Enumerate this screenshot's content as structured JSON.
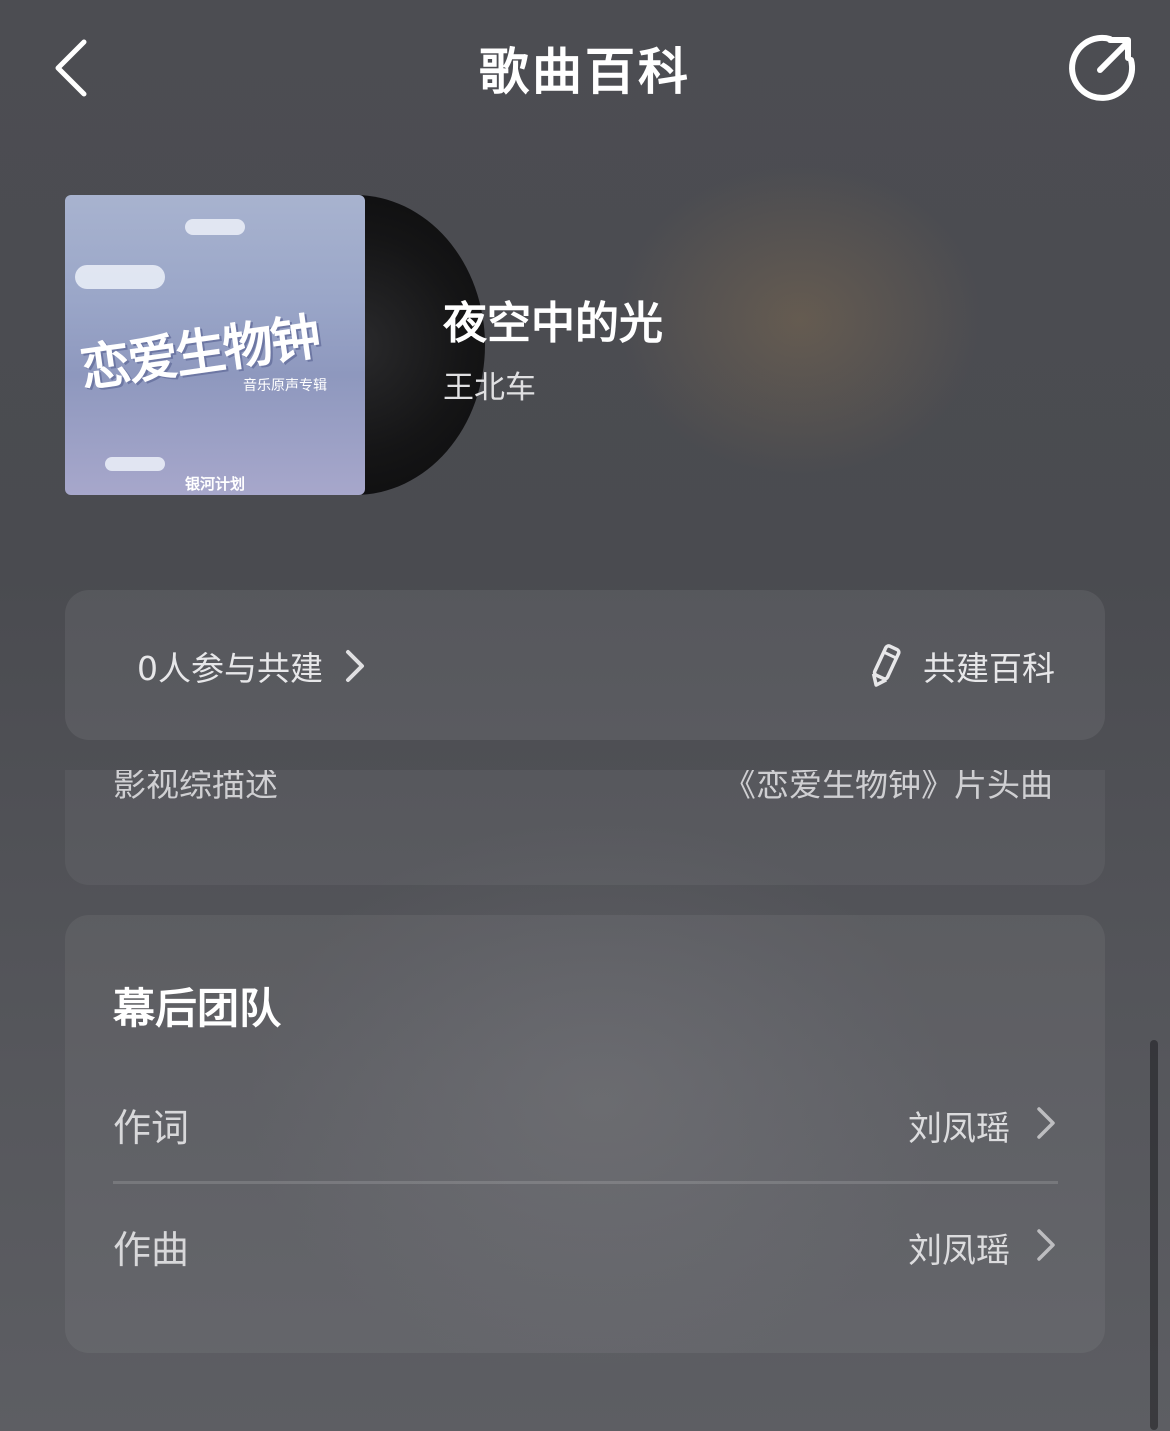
{
  "header": {
    "title": "歌曲百科",
    "back_icon": "chevron-left-icon",
    "share_icon": "share-arrow-icon"
  },
  "song": {
    "title": "夜空中的光",
    "artist": "王北车",
    "cover": {
      "title": "恋爱生物钟",
      "subtitle": "音乐原声专辑",
      "brand": "银河计划"
    }
  },
  "cobuild": {
    "participants_label": "0人参与共建",
    "action_label": "共建百科"
  },
  "description": {
    "label": "影视综描述",
    "value": "《恋爱生物钟》片头曲"
  },
  "team": {
    "title": "幕后团队",
    "rows": [
      {
        "role": "作词",
        "person": "刘凤瑶"
      },
      {
        "role": "作曲",
        "person": "刘凤瑶"
      }
    ]
  },
  "colors": {
    "background": "#4c4d52",
    "text_primary": "#ffffff",
    "text_secondary": "#d8d8da"
  }
}
